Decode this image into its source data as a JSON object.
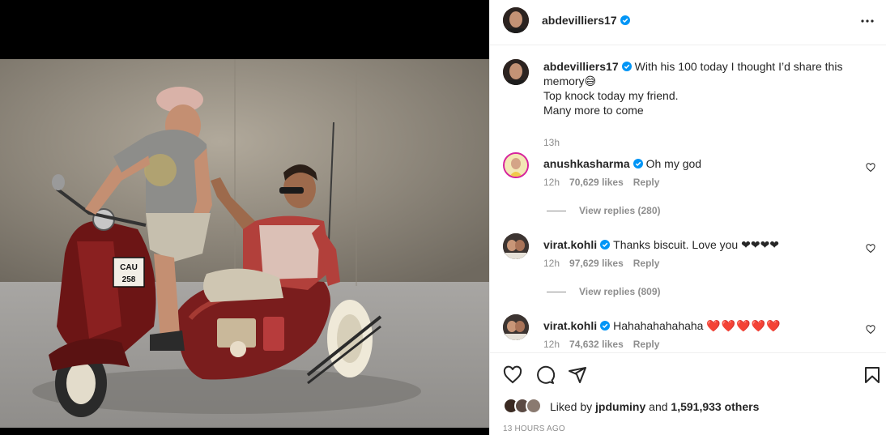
{
  "post": {
    "author": "abdevilliers17",
    "caption_line1": "With his 100 today I thought I’d share this",
    "caption_line2": "memory😅",
    "caption_line3": "Top knock today my friend.",
    "caption_line4": "Many more to come",
    "caption_time": "13h",
    "image_plate_line1": "CAU",
    "image_plate_line2": "258"
  },
  "comments": [
    {
      "user": "anushkasharma",
      "text": "Oh my god",
      "time": "12h",
      "likes": "70,629 likes",
      "reply": "Reply",
      "view_replies": "View replies (280)"
    },
    {
      "user": "virat.kohli",
      "text": "Thanks biscuit. Love you ❤❤❤❤",
      "time": "12h",
      "likes": "97,629 likes",
      "reply": "Reply",
      "view_replies": "View replies (809)"
    },
    {
      "user": "virat.kohli",
      "text": "Hahahahahahaha",
      "hearts": "❤️❤️❤️❤️❤️",
      "time": "12h",
      "likes": "74,632 likes",
      "reply": "Reply"
    }
  ],
  "likes": {
    "prefix": "Liked by",
    "user": "jpduminy",
    "and": "and",
    "count": "1,591,933 others"
  },
  "timestamp": "13 HOURS AGO",
  "icons": [
    "more-options-icon",
    "verified-badge-icon",
    "heart-icon",
    "comment-icon",
    "share-icon",
    "bookmark-icon"
  ],
  "colors": {
    "verified": "#0095f6",
    "text": "#262626",
    "muted": "#8e8e8e",
    "heart_red": "#ed4956"
  }
}
